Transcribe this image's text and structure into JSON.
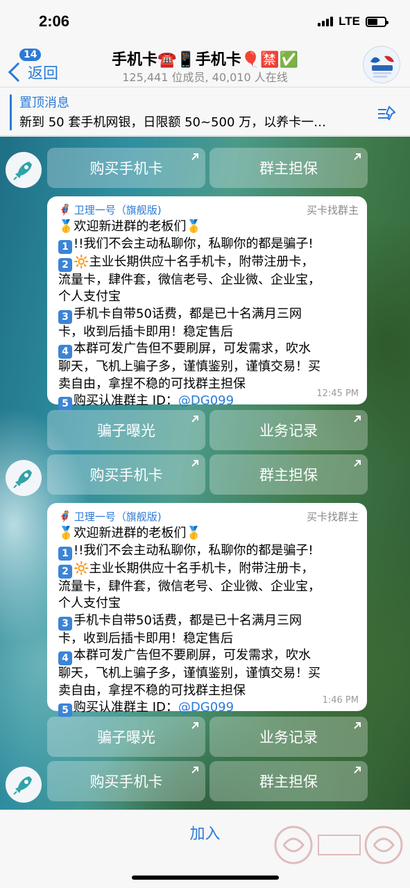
{
  "status_bar": {
    "time": "2:06",
    "network": "LTE"
  },
  "header": {
    "back_badge": "14",
    "back_label": "返回",
    "title": "手机卡☎️📱手机卡🎈🈲✅",
    "subtitle": "125,441 位成员, 40,010 人在线"
  },
  "pinned": {
    "title": "置顶消息",
    "text": "新到 50 套手机网银，日限额 50~500 万，以养卡一…"
  },
  "keyboards": {
    "buy_card": "购买手机卡",
    "owner_guarantee": "群主担保",
    "scam_expose": "骗子曝光",
    "business_record": "业务记录"
  },
  "messages": [
    {
      "sender": "卫理一号（旗舰版)",
      "role": "买卡找群主",
      "welcome": "欢迎新进群的老板们",
      "line1": "!!我们不会主动私聊你，私聊你的都是骗子!",
      "line2a": "主业长期供应十名手机卡，附带注册卡，",
      "line2b": "流量卡，肆件套，微信老号、企业微、企业宝，",
      "line2c": "个人支付宝",
      "line3a": "手机卡自带50话费，都是已十名满月三网",
      "line3b": "卡，收到后插卡即用！稳定售后",
      "line4a": "本群可发广告但不要刷屏，可发需求，吹水",
      "line4b": "聊天，飞机上骗子多，谨慎鉴别，谨慎交易！买",
      "line4c": "卖自由，拿捏不稳的可找群主担保",
      "line5": "购买认准群主 ID：",
      "mention": "@DG099",
      "time": "12:45 PM"
    },
    {
      "sender": "卫理一号（旗舰版)",
      "role": "买卡找群主",
      "welcome": "欢迎新进群的老板们",
      "line1": "!!我们不会主动私聊你，私聊你的都是骗子!",
      "line2a": "主业长期供应十名手机卡，附带注册卡，",
      "line2b": "流量卡，肆件套，微信老号、企业微、企业宝，",
      "line2c": "个人支付宝",
      "line3a": "手机卡自带50话费，都是已十名满月三网",
      "line3b": "卡，收到后插卡即用！稳定售后",
      "line4a": "本群可发广告但不要刷屏，可发需求，吹水",
      "line4b": "聊天，飞机上骗子多，谨慎鉴别，谨慎交易！买",
      "line4c": "卖自由，拿捏不稳的可找群主担保",
      "line5": "购买认准群主 ID：",
      "mention": "@DG099",
      "time": "1:46 PM"
    }
  ],
  "footer": {
    "join_label": "加入"
  },
  "num_labels": [
    "1",
    "2",
    "3",
    "4",
    "5"
  ],
  "colors": {
    "accent": "#2b7ad6",
    "bubble": "#ffffff"
  }
}
